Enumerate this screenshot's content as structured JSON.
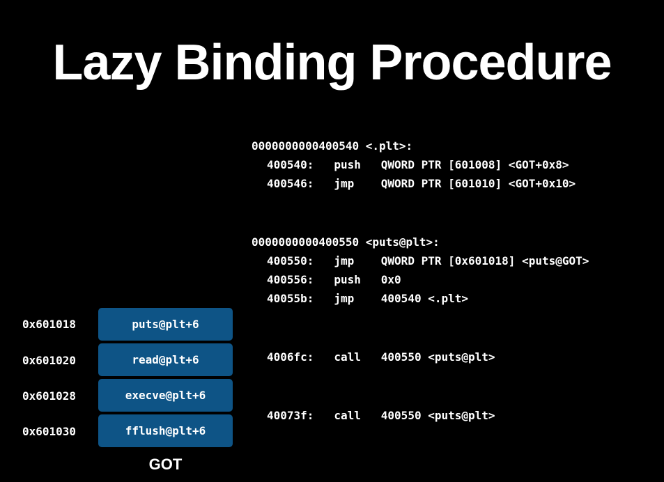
{
  "title": "Lazy Binding Procedure",
  "colors": {
    "background": "#000000",
    "text": "#ffffff",
    "got_cell": "#0e5486"
  },
  "assembly": {
    "plt_header": "0000000000400540 <.plt>:",
    "plt_lines": [
      {
        "addr": "400540:",
        "op": "push",
        "args": "QWORD PTR [601008] <GOT+0x8>"
      },
      {
        "addr": "400546:",
        "op": "jmp",
        "args": "QWORD PTR [601010] <GOT+0x10>"
      }
    ],
    "puts_header": "0000000000400550 <puts@plt>:",
    "puts_lines": [
      {
        "addr": "400550:",
        "op": "jmp",
        "args": "QWORD PTR [0x601018] <puts@GOT>"
      },
      {
        "addr": "400556:",
        "op": "push",
        "args": "0x0"
      },
      {
        "addr": "40055b:",
        "op": "jmp",
        "args": "400540 <.plt>"
      }
    ],
    "calls": [
      {
        "addr": "4006fc:",
        "op": "call",
        "args": "400550 <puts@plt>"
      },
      {
        "addr": "40073f:",
        "op": "call",
        "args": "400550 <puts@plt>"
      }
    ]
  },
  "got": {
    "label": "GOT",
    "entries": [
      {
        "address": "0x601018",
        "value": "puts@plt+6"
      },
      {
        "address": "0x601020",
        "value": "read@plt+6"
      },
      {
        "address": "0x601028",
        "value": "execve@plt+6"
      },
      {
        "address": "0x601030",
        "value": "fflush@plt+6"
      }
    ]
  }
}
